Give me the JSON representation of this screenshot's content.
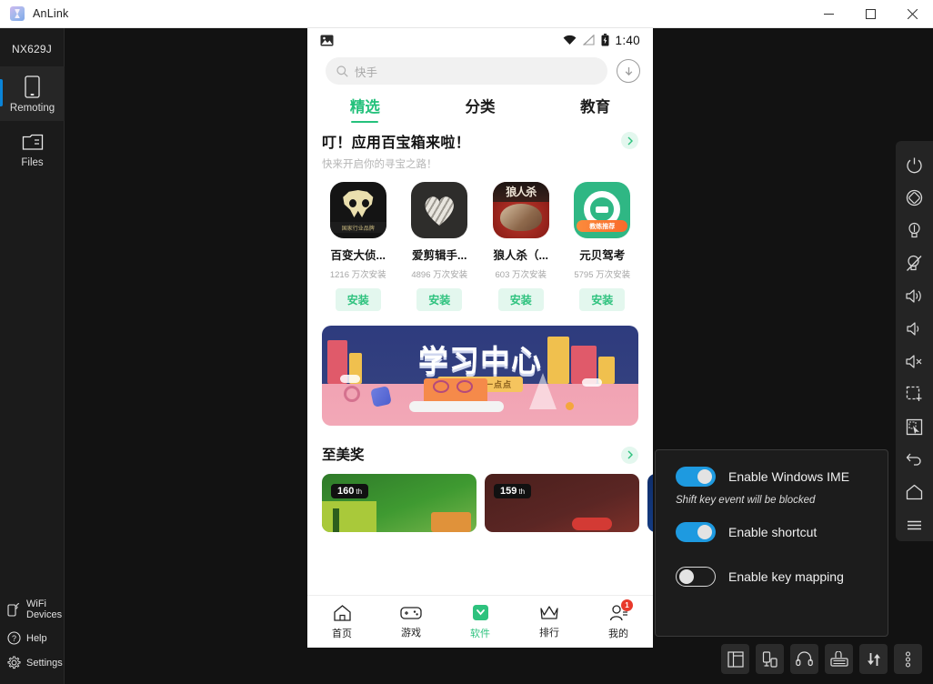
{
  "window": {
    "title": "AnLink",
    "logo_icon": "anlink-logo-icon",
    "minimize_label": "–",
    "maximize_label": "□",
    "close_label": "✕"
  },
  "sidebar": {
    "device_name": "NX629J",
    "items": [
      {
        "label": "Remoting",
        "icon": "phone-icon",
        "active": true
      },
      {
        "label": "Files",
        "icon": "folder-icon",
        "active": false
      }
    ],
    "bottom_items": [
      {
        "label": "WiFi\nDevices",
        "line1": "WiFi",
        "line2": "Devices",
        "icon": "wifi-device-icon"
      },
      {
        "label": "Help",
        "icon": "help-circle-icon"
      },
      {
        "label": "Settings",
        "icon": "gear-icon"
      }
    ]
  },
  "phone": {
    "status_bar": {
      "left_icon": "image-icon",
      "wifi_icon": "wifi-icon",
      "signal_icon": "signal-off-icon",
      "battery_icon": "battery-icon",
      "time": "1:40"
    },
    "search": {
      "icon": "search-icon",
      "value": "快手",
      "placeholder": "快手",
      "download_icon": "download-arrow-icon"
    },
    "tabs": [
      {
        "label": "精选",
        "active": true
      },
      {
        "label": "分类",
        "active": false
      },
      {
        "label": "教育",
        "active": false
      }
    ],
    "promo": {
      "title": "叮！应用百宝箱来啦！",
      "subtitle": "快来开启你的寻宝之路！",
      "arrow_icon": "chevron-right-icon"
    },
    "apps": [
      {
        "name": "百变大侦...",
        "installs": "1216 万次安装",
        "button": "安装",
        "icon": "baibian-daizhentan-icon",
        "badge": "国家行业品牌"
      },
      {
        "name": "爱剪辑手...",
        "installs": "4896 万次安装",
        "button": "安装",
        "icon": "aijianji-icon"
      },
      {
        "name": "狼人杀（...",
        "installs": "603 万次安装",
        "button": "安装",
        "icon": "langrensha-icon",
        "badge": "狼人杀"
      },
      {
        "name": "元贝驾考",
        "installs": "5795 万次安装",
        "button": "安装",
        "icon": "yuanbei-jiakao-icon",
        "badge": "教练推荐"
      }
    ],
    "banner": {
      "title": "学习中心",
      "subtitle": "每天进步一点点"
    },
    "award_section": {
      "title": "至美奖",
      "arrow_icon": "chevron-right-icon",
      "cards": [
        {
          "rank": "160",
          "suffix": "th"
        },
        {
          "rank": "159",
          "suffix": "th"
        },
        {
          "rank": "",
          "suffix": ""
        }
      ]
    },
    "bottom_nav": [
      {
        "label": "首页",
        "icon": "home-icon",
        "active": false,
        "badge": ""
      },
      {
        "label": "游戏",
        "icon": "gamepad-icon",
        "active": false,
        "badge": ""
      },
      {
        "label": "软件",
        "icon": "apps-icon",
        "active": true,
        "badge": ""
      },
      {
        "label": "排行",
        "icon": "crown-icon",
        "active": false,
        "badge": ""
      },
      {
        "label": "我的",
        "icon": "user-icon",
        "active": false,
        "badge": "1"
      }
    ]
  },
  "right_toolbar": [
    {
      "icon": "power-icon",
      "name": "power-button"
    },
    {
      "icon": "rotate-icon",
      "name": "rotate-screen-button"
    },
    {
      "icon": "lightbulb-icon",
      "name": "screen-on-button"
    },
    {
      "icon": "lightbulb-off-icon",
      "name": "screen-off-button"
    },
    {
      "icon": "volume-up-icon",
      "name": "volume-up-button"
    },
    {
      "icon": "volume-down-icon",
      "name": "volume-down-button"
    },
    {
      "icon": "volume-mute-icon",
      "name": "volume-mute-button"
    },
    {
      "icon": "screenshot-icon",
      "name": "capture-region-button"
    },
    {
      "icon": "screen-record-icon",
      "name": "screen-record-button"
    },
    {
      "icon": "back-icon",
      "name": "back-button"
    },
    {
      "icon": "home-icon",
      "name": "home-button"
    },
    {
      "icon": "menu-icon",
      "name": "recent-apps-button"
    }
  ],
  "bottom_toolbar": [
    {
      "icon": "layout-icon",
      "name": "layout-button"
    },
    {
      "icon": "multi-device-icon",
      "name": "multi-device-button"
    },
    {
      "icon": "headset-icon",
      "name": "audio-button"
    },
    {
      "icon": "keyboard-icon",
      "name": "keyboard-button"
    },
    {
      "icon": "transfer-icon",
      "name": "file-transfer-button"
    },
    {
      "icon": "more-dots-icon",
      "name": "more-options-button"
    }
  ],
  "settings_popup": {
    "rows": [
      {
        "label": "Enable Windows IME",
        "state": "on"
      },
      {
        "label": "Enable shortcut",
        "state": "on"
      },
      {
        "label": "Enable key mapping",
        "state": "off"
      }
    ],
    "hint": "Shift key event will be blocked"
  },
  "colors": {
    "accent_blue": "#1e9ae0",
    "accent_green": "#2ec27e",
    "sidebar_bg": "#1b1b1b",
    "badge_red": "#e8392b"
  }
}
